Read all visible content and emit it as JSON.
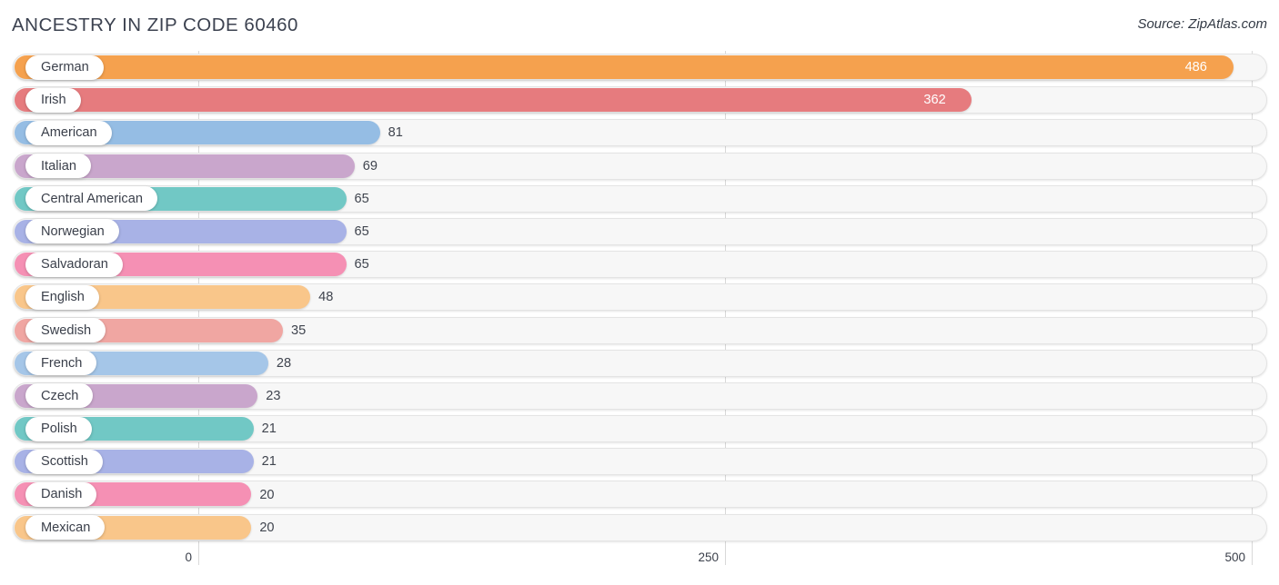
{
  "header": {
    "title": "ANCESTRY IN ZIP CODE 60460",
    "source": "Source: ZipAtlas.com"
  },
  "axis": {
    "ticks": [
      "0",
      "250",
      "500"
    ],
    "tick_values": [
      0,
      250,
      500
    ]
  },
  "colors": {
    "german": "#F5A14E",
    "irish": "#E67B7E",
    "american": "#95BDE4",
    "italian": "#C9A6CC",
    "central_american": "#71C8C5",
    "norwegian": "#A8B2E6",
    "salvadoran": "#F590B4",
    "english": "#F9C68A",
    "swedish": "#F0A6A2",
    "french": "#A5C6E8",
    "czech": "#C9A6CC",
    "polish": "#71C8C5",
    "scottish": "#A8B2E6",
    "danish": "#F590B4",
    "mexican": "#F9C68A",
    "track": "#F7F7F7",
    "gridline": "#D9D9D9",
    "text": "#3A3F4A"
  },
  "chart_data": {
    "type": "bar",
    "orientation": "horizontal",
    "title": "ANCESTRY IN ZIP CODE 60460",
    "xlabel": "",
    "ylabel": "",
    "xlim": [
      0,
      500
    ],
    "grid": true,
    "legend": null,
    "categories": [
      "German",
      "Irish",
      "American",
      "Italian",
      "Central American",
      "Norwegian",
      "Salvadoran",
      "English",
      "Swedish",
      "French",
      "Czech",
      "Polish",
      "Scottish",
      "Danish",
      "Mexican"
    ],
    "values": [
      486,
      362,
      81,
      69,
      65,
      65,
      65,
      48,
      35,
      28,
      23,
      21,
      21,
      20,
      20
    ],
    "bars": [
      {
        "label": "German",
        "value": 486,
        "value_text": "486",
        "color": "#F5A14E",
        "label_inside": true
      },
      {
        "label": "Irish",
        "value": 362,
        "value_text": "362",
        "color": "#E67B7E",
        "label_inside": true
      },
      {
        "label": "American",
        "value": 81,
        "value_text": "81",
        "color": "#95BDE4",
        "label_inside": false
      },
      {
        "label": "Italian",
        "value": 69,
        "value_text": "69",
        "color": "#C9A6CC",
        "label_inside": false
      },
      {
        "label": "Central American",
        "value": 65,
        "value_text": "65",
        "color": "#71C8C5",
        "label_inside": false
      },
      {
        "label": "Norwegian",
        "value": 65,
        "value_text": "65",
        "color": "#A8B2E6",
        "label_inside": false
      },
      {
        "label": "Salvadoran",
        "value": 65,
        "value_text": "65",
        "color": "#F590B4",
        "label_inside": false
      },
      {
        "label": "English",
        "value": 48,
        "value_text": "48",
        "color": "#F9C68A",
        "label_inside": false
      },
      {
        "label": "Swedish",
        "value": 35,
        "value_text": "35",
        "color": "#F0A6A2",
        "label_inside": false
      },
      {
        "label": "French",
        "value": 28,
        "value_text": "28",
        "color": "#A5C6E8",
        "label_inside": false
      },
      {
        "label": "Czech",
        "value": 23,
        "value_text": "23",
        "color": "#C9A6CC",
        "label_inside": false
      },
      {
        "label": "Polish",
        "value": 21,
        "value_text": "21",
        "color": "#71C8C5",
        "label_inside": false
      },
      {
        "label": "Scottish",
        "value": 21,
        "value_text": "21",
        "color": "#A8B2E6",
        "label_inside": false
      },
      {
        "label": "Danish",
        "value": 20,
        "value_text": "20",
        "color": "#F590B4",
        "label_inside": false
      },
      {
        "label": "Mexican",
        "value": 20,
        "value_text": "20",
        "color": "#F9C68A",
        "label_inside": false
      }
    ]
  }
}
